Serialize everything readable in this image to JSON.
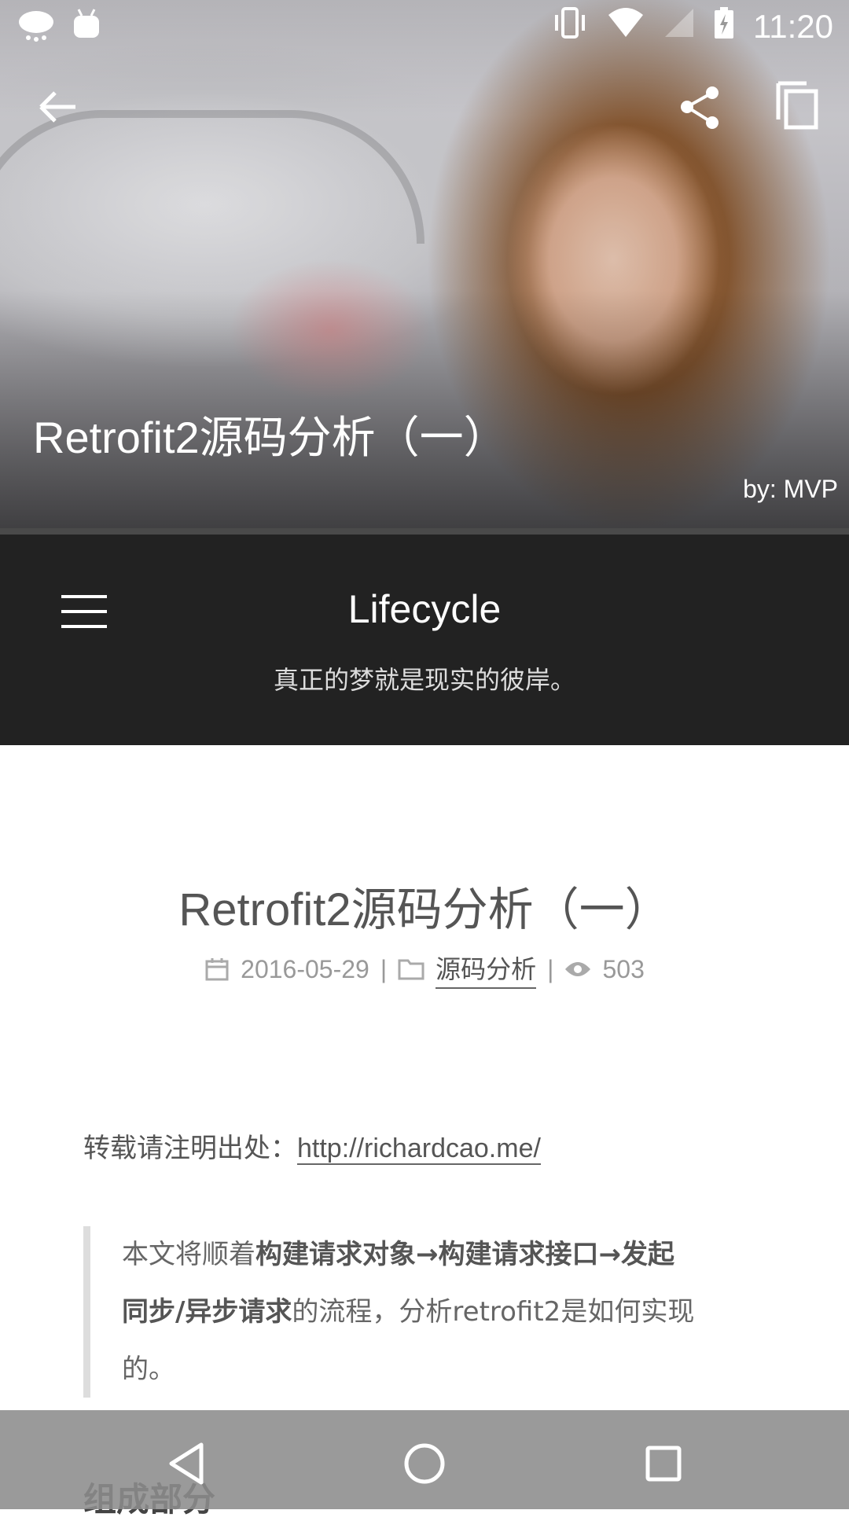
{
  "status_bar": {
    "time": "11:20",
    "left_icons": [
      "weather-icon",
      "android-icon"
    ],
    "right_icons": [
      "vibrate-icon",
      "wifi-icon",
      "signal-icon",
      "battery-icon"
    ]
  },
  "hero": {
    "title": "Retrofit2源码分析（一）",
    "author": "by: MVP",
    "buttons": [
      "back-arrow-icon",
      "share-icon",
      "copy-icon"
    ]
  },
  "blog_header": {
    "site_title": "Lifecycle",
    "subtitle": "真正的梦就是现实的彼岸。"
  },
  "article": {
    "title": "Retrofit2源码分析（一）",
    "meta": {
      "date": "2016-05-29",
      "separator": "|",
      "category": "源码分析",
      "views": "503"
    },
    "repost_prefix": "转载请注明出处：",
    "repost_link": "http://richardcao.me/",
    "quote": {
      "intro": "本文将顺着",
      "bold1": "构建请求对象→构建请求接口→发起",
      "bold2": "同步/异步请求",
      "rest1": "的流程，分析retrofit2是如何实现",
      "rest2": "的。"
    },
    "section_heading": "组成部分"
  },
  "navbar": {
    "buttons": [
      "back-triangle-icon",
      "home-circle-icon",
      "recents-square-icon"
    ]
  }
}
